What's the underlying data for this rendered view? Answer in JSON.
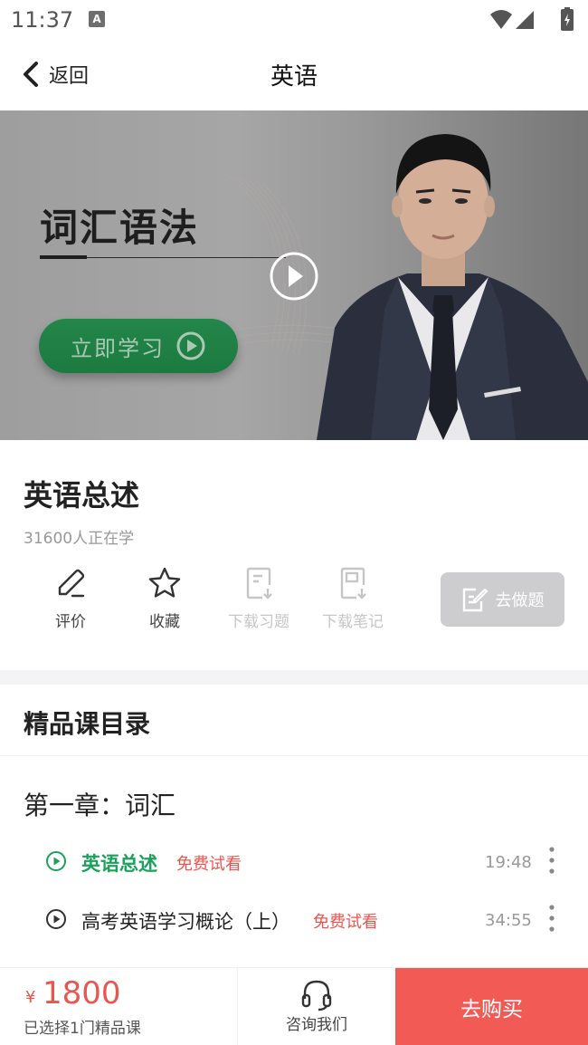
{
  "status_bar": {
    "time": "11:37",
    "notification_icon": "A",
    "icons": [
      "wifi-icon",
      "signal-icon",
      "battery-icon"
    ]
  },
  "header": {
    "back_label": "返回",
    "title": "英语"
  },
  "banner": {
    "course_name": "词汇语法",
    "study_button": "立即学习",
    "accent_color": "#1c7a41"
  },
  "course": {
    "title": "英语总述",
    "learners": "31600人正在学",
    "actions": [
      {
        "label": "评价",
        "icon": "pencil-icon",
        "enabled": true
      },
      {
        "label": "收藏",
        "icon": "star-icon",
        "enabled": true
      },
      {
        "label": "下载习题",
        "icon": "download-doc-icon",
        "enabled": false
      },
      {
        "label": "下载笔记",
        "icon": "download-note-icon",
        "enabled": false
      }
    ],
    "quiz_button": "去做题"
  },
  "catalog": {
    "heading": "精品课目录",
    "chapter": "第一章：词汇",
    "lessons": [
      {
        "title": "英语总述",
        "badge": "免费试看",
        "duration": "19:48",
        "active": true
      },
      {
        "title": "高考英语学习概论（上）",
        "badge": "免费试看",
        "duration": "34:55",
        "active": false
      }
    ]
  },
  "bottom_bar": {
    "currency": "¥",
    "price": "1800",
    "selected_text": "已选择1门精品课",
    "consult_label": "咨询我们",
    "buy_label": "去购买",
    "buy_color": "#f15a55"
  }
}
